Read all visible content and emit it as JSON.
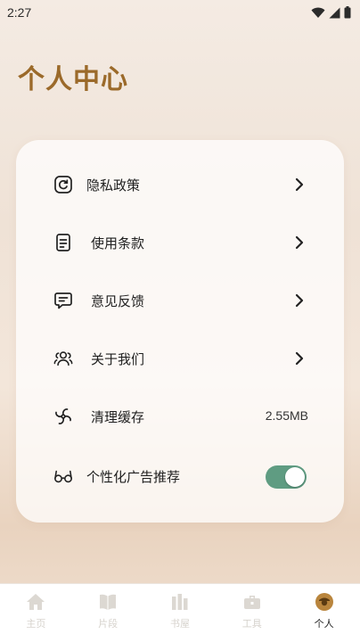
{
  "status_bar": {
    "time": "2:27",
    "icons": [
      "wifi-icon",
      "signal-icon",
      "battery-icon"
    ]
  },
  "page": {
    "title": "个人中心"
  },
  "menu": {
    "items": [
      {
        "icon": "privacy-icon",
        "label": "隐私政策",
        "trailing": "chevron"
      },
      {
        "icon": "terms-icon",
        "label": "使用条款",
        "trailing": "chevron"
      },
      {
        "icon": "feedback-icon",
        "label": "意见反馈",
        "trailing": "chevron"
      },
      {
        "icon": "about-icon",
        "label": "关于我们",
        "trailing": "chevron"
      },
      {
        "icon": "clear-cache-icon",
        "label": "清理缓存",
        "trailing": "value",
        "value": "2.55MB"
      },
      {
        "icon": "glasses-icon",
        "label": "个性化广告推荐",
        "trailing": "toggle",
        "toggle_on": true
      }
    ]
  },
  "bottom_nav": {
    "items": [
      {
        "icon": "home-icon",
        "label": "主页",
        "active": false
      },
      {
        "icon": "book-icon",
        "label": "片段",
        "active": false
      },
      {
        "icon": "bookshelf-icon",
        "label": "书屋",
        "active": false
      },
      {
        "icon": "toolbox-icon",
        "label": "工具",
        "active": false
      },
      {
        "icon": "profile-icon",
        "label": "个人",
        "active": true
      }
    ]
  },
  "colors": {
    "title": "#9b6a2a",
    "toggle_on": "#5f9c82",
    "nav_inactive": "#d6d2cc",
    "nav_active_icon": "#b9853d"
  }
}
